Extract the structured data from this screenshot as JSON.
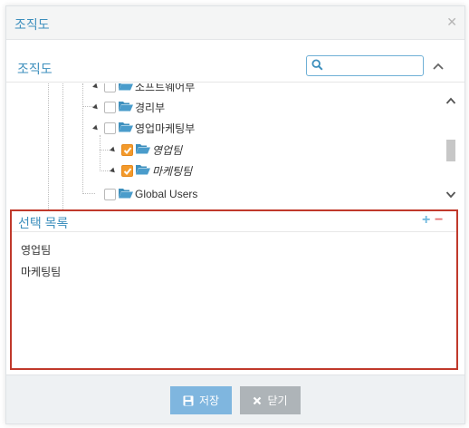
{
  "dialog": {
    "title": "조직도",
    "close_icon": "close-icon"
  },
  "org": {
    "label": "조직도",
    "search": {
      "value": "",
      "placeholder": ""
    }
  },
  "tree": {
    "nodes": [
      {
        "label": "소프트웨어부",
        "checked": false,
        "italic": false
      },
      {
        "label": "경리부",
        "checked": false,
        "italic": false
      },
      {
        "label": "영업마케팅부",
        "checked": false,
        "italic": false
      },
      {
        "label": "영업팀",
        "checked": true,
        "italic": true
      },
      {
        "label": "마케팅팀",
        "checked": true,
        "italic": true
      },
      {
        "label": "Global Users",
        "checked": false,
        "italic": false
      }
    ]
  },
  "selected": {
    "label": "선택 목록",
    "items": [
      "영업팀",
      "마케팅팀"
    ]
  },
  "footer": {
    "save_label": "저장",
    "close_label": "닫기"
  },
  "colors": {
    "accent": "#3d8fbd",
    "checkbox_on": "#f39a2b",
    "folder": "#3d8fbd",
    "panel_border": "#c0392b",
    "save_button": "#7fb6df",
    "close_button": "#aeb4b8"
  }
}
